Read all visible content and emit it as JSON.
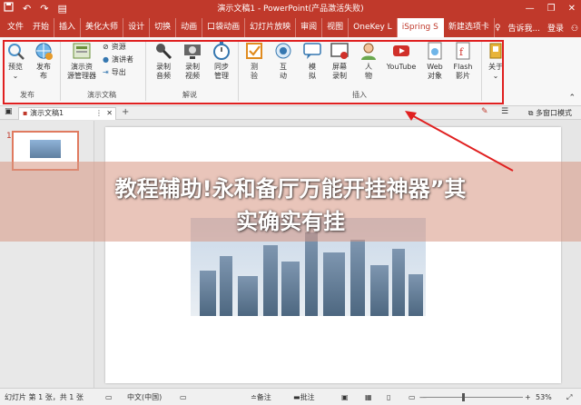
{
  "titlebar": {
    "title": "演示文稿1 - PowerPoint(产品激活失败)",
    "qa_icons": [
      "save-icon",
      "undo-icon",
      "redo-icon",
      "start-icon"
    ],
    "minimize": "—",
    "restore": "❐",
    "close": "✕"
  },
  "tabs": [
    {
      "label": "文件"
    },
    {
      "label": "开始"
    },
    {
      "label": "插入"
    },
    {
      "label": "美化大师"
    },
    {
      "label": "设计"
    },
    {
      "label": "切换"
    },
    {
      "label": "动画"
    },
    {
      "label": "口袋动画"
    },
    {
      "label": "幻灯片放映"
    },
    {
      "label": "审阅"
    },
    {
      "label": "视图"
    },
    {
      "label": "OneKey L"
    },
    {
      "label": "iSpring S"
    },
    {
      "label": "新建选项卡"
    }
  ],
  "tabs_right": {
    "tellme": "告诉我...",
    "login": "登录",
    "share": "共享"
  },
  "ribbon": {
    "groups": {
      "publish": "发布",
      "presentation": "演示文稿",
      "narration": "解说",
      "insert": "插入"
    },
    "buttons": {
      "preview": "预览",
      "publish": "发布",
      "resource_manager_1": "演示资",
      "resource_manager_2": "源管理器",
      "resources": "资源",
      "presenter": "演讲者",
      "export": "导出",
      "record_audio_1": "录制",
      "record_audio_2": "音频",
      "record_video_1": "录制",
      "record_video_2": "视频",
      "sync_1": "同步",
      "sync_2": "管理",
      "quiz_1": "测",
      "quiz_2": "验",
      "interaction_1": "互",
      "interaction_2": "动",
      "simulation_1": "模",
      "simulation_2": "拟",
      "screen_record_1": "屏幕",
      "screen_record_2": "录制",
      "character_1": "人",
      "character_2": "物",
      "youtube": "YouTube",
      "web_1": "Web",
      "web_2": "对象",
      "flash_1": "Flash",
      "flash_2": "影片",
      "about": "关于"
    }
  },
  "doc_tab": {
    "label": "演示文稿1",
    "multi_window": "多窗口模式"
  },
  "thumbs": {
    "slide_number": "1"
  },
  "banner": {
    "line1": "教程辅助!永和备厅万能开挂神器”其",
    "line2": "实确实有挂"
  },
  "status": {
    "slide_info": "幻灯片 第 1 张，共 1 张",
    "language": "中文(中国)",
    "notes": "备注",
    "comments": "批注",
    "zoom_minus": "—",
    "zoom_plus": "+",
    "zoom": "53%"
  },
  "colors": {
    "accent": "#c0392b",
    "highlight_box": "#e02020"
  }
}
